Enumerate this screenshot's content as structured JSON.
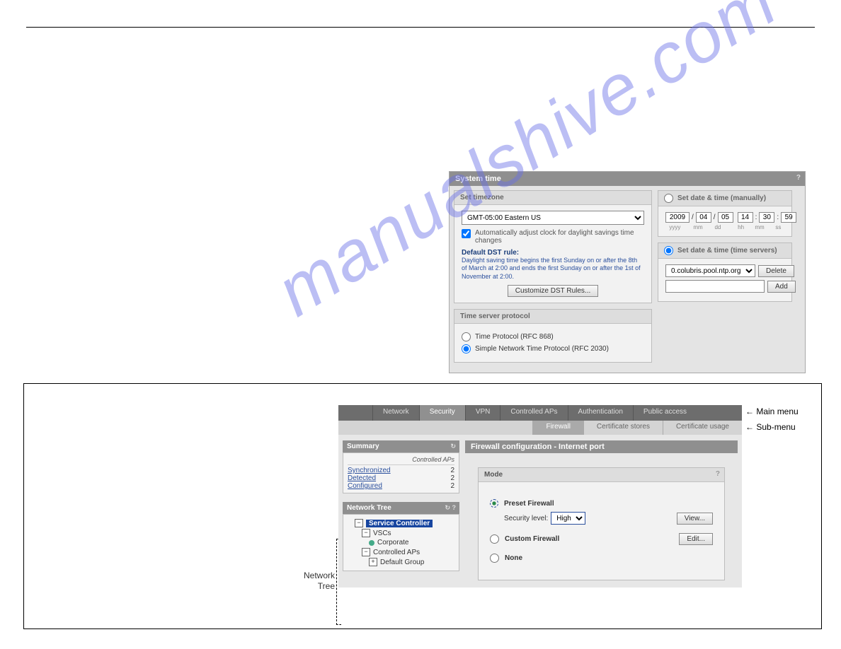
{
  "watermark": "manualshive.com",
  "shot1": {
    "title": "System time",
    "timezone_box": {
      "heading": "Set timezone",
      "selected": "GMT-05:00 Eastern US",
      "auto_dst_label": "Automatically adjust clock for daylight savings time changes",
      "default_rule_h": "Default DST rule:",
      "default_rule_desc": "Daylight saving time begins the first Sunday on or after the 8th of March at 2:00 and ends the first Sunday on or after the 1st of November at 2:00.",
      "customize_btn": "Customize DST Rules..."
    },
    "manual_box": {
      "heading": "Set date & time (manually)",
      "yyyy": "2009",
      "mm": "04",
      "dd": "05",
      "hh": "14",
      "mi": "30",
      "ss": "59",
      "labels": {
        "y": "yyyy",
        "mo": "mm",
        "d": "dd",
        "h": "hh",
        "m": "mm",
        "s": "ss"
      }
    },
    "servers_box": {
      "heading": "Set date & time (time servers)",
      "selected": "0.colubris.pool.ntp.org",
      "delete_btn": "Delete",
      "add_btn": "Add"
    },
    "protocol_box": {
      "heading": "Time server protocol",
      "opt1": "Time Protocol (RFC 868)",
      "opt2": "Simple Network Time Protocol (RFC 2030)"
    }
  },
  "shot2": {
    "mainmenu": [
      "Network",
      "Security",
      "VPN",
      "Controlled APs",
      "Authentication",
      "Public access"
    ],
    "mainmenu_active": 1,
    "submenu": [
      "Firewall",
      "Certificate stores",
      "Certificate usage"
    ],
    "submenu_active": 0,
    "summary": {
      "title": "Summary",
      "col_header": "Controlled APs",
      "rows": [
        {
          "label": "Synchronized",
          "value": "2"
        },
        {
          "label": "Detected",
          "value": "2"
        },
        {
          "label": "Configured",
          "value": "2"
        }
      ]
    },
    "tree": {
      "title": "Network Tree",
      "root": "Service Controller",
      "n_vscs": "VSCs",
      "n_corp": "Corporate",
      "n_caps": "Controlled APs",
      "n_def": "Default Group"
    },
    "fw": {
      "title": "Firewall configuration - Internet port",
      "mode_h": "Mode",
      "preset": "Preset Firewall",
      "sec_level_lbl": "Security level:",
      "sec_level": "High",
      "view_btn": "View...",
      "custom": "Custom Firewall",
      "edit_btn": "Edit...",
      "none": "None"
    }
  },
  "annotations": {
    "main_menu": "Main menu",
    "sub_menu": "Sub-menu",
    "network_tree": "Network\nTree"
  }
}
